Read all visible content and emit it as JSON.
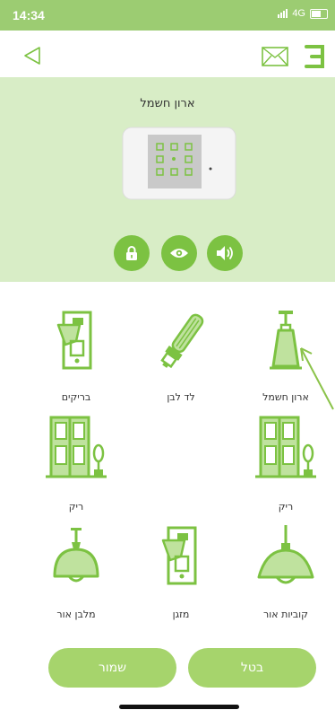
{
  "status_bar": {
    "time": "14:34",
    "network": "4G"
  },
  "device": {
    "title": "ארון חשמל"
  },
  "controls": [
    {
      "icon": "lock-icon"
    },
    {
      "icon": "eye-icon"
    },
    {
      "icon": "speaker-icon"
    }
  ],
  "grid": [
    {
      "label": "ארון חשמל",
      "icon": "pendant-lamp-icon"
    },
    {
      "label": "לד לבן",
      "icon": "led-bulb-icon"
    },
    {
      "label": "בריקים",
      "icon": "light-switch-icon"
    },
    {
      "label": "ריק",
      "icon": "door-plant-icon"
    },
    {
      "label": "",
      "icon": ""
    },
    {
      "label": "ריק",
      "icon": "door-plant-icon"
    },
    {
      "label": "קוביות אור",
      "icon": "pendant-lamp-icon"
    },
    {
      "label": "מזגן",
      "icon": "light-switch-icon"
    },
    {
      "label": "מלבן אור",
      "icon": "dome-lamp-icon"
    }
  ],
  "buttons": {
    "cancel": "בטל",
    "save": "שמור"
  },
  "colors": {
    "accent": "#7cc242",
    "panel_bg": "#d8edc6",
    "status_bar": "#9ccc72",
    "button": "#a6d46c"
  }
}
